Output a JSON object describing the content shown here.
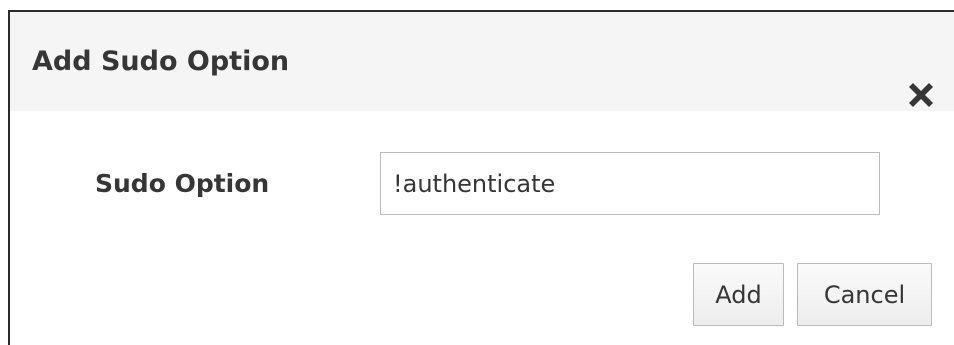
{
  "dialog": {
    "title": "Add Sudo Option",
    "close_icon": "close-icon"
  },
  "form": {
    "field_label": "Sudo Option",
    "field_value": "!authenticate"
  },
  "buttons": {
    "add_label": "Add",
    "cancel_label": "Cancel"
  },
  "colors": {
    "header_bg": "#f5f5f5",
    "text": "#363636",
    "border": "#bbbbbb"
  }
}
